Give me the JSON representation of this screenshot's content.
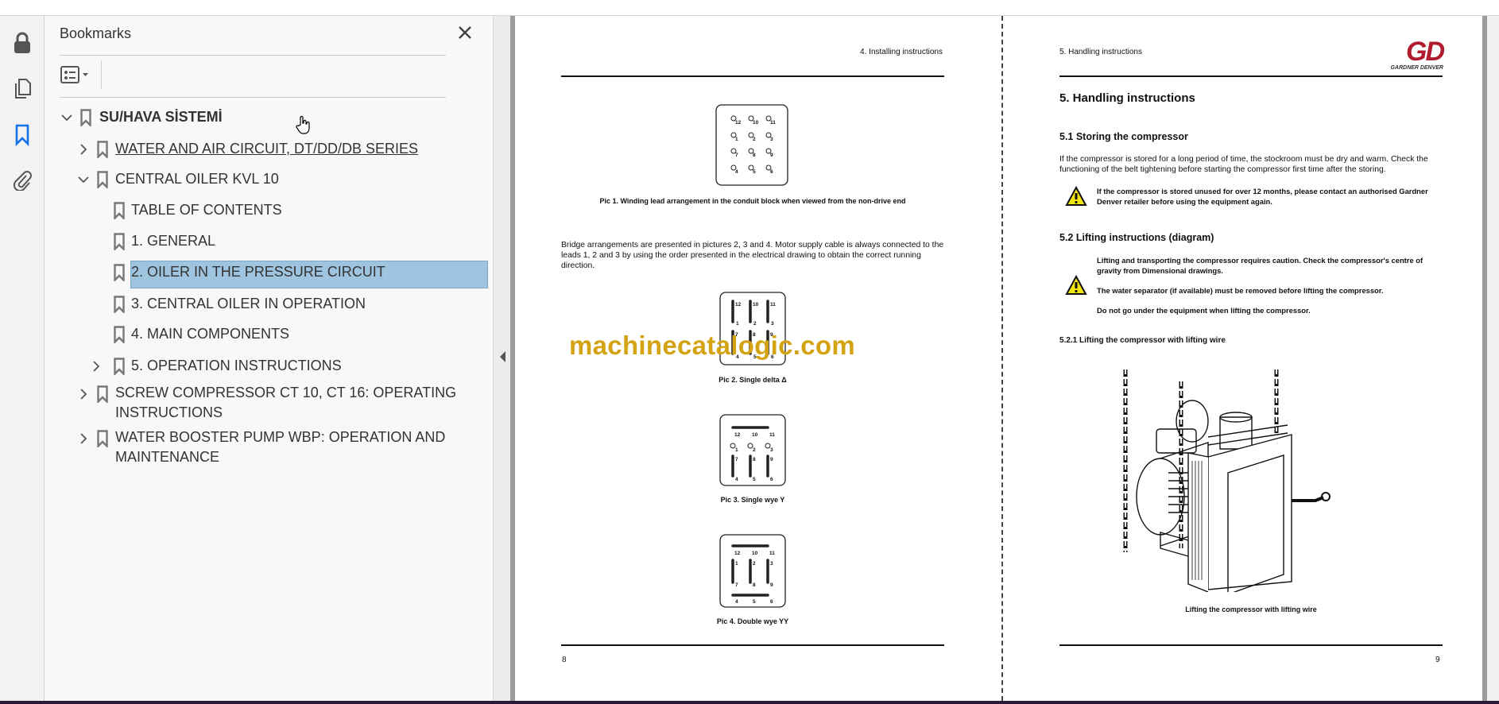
{
  "bookmarks_panel": {
    "title": "Bookmarks",
    "tree": [
      {
        "label": "SU/HAVA SİSTEMİ",
        "expanded": true
      },
      {
        "label": "WATER AND AIR CIRCUIT, DT/DD/DB SERIES",
        "expanded": false
      },
      {
        "label": "CENTRAL OILER KVL 10",
        "expanded": true
      },
      {
        "label": "TABLE OF CONTENTS"
      },
      {
        "label": "1. GENERAL"
      },
      {
        "label": "2. OILER IN THE PRESSURE CIRCUIT",
        "selected": true
      },
      {
        "label": "3. CENTRAL OILER IN OPERATION"
      },
      {
        "label": "4. MAIN COMPONENTS"
      },
      {
        "label": "5. OPERATION INSTRUCTIONS",
        "expanded": false
      },
      {
        "label_lines": [
          "SCREW COMPRESSOR CT 10, CT 16: OPERATING",
          "INSTRUCTIONS"
        ],
        "expanded": false
      },
      {
        "label_lines": [
          "WATER BOOSTER PUMP WBP: OPERATION AND",
          "MAINTENANCE"
        ],
        "expanded": false
      }
    ]
  },
  "page_left": {
    "header": "4. Installing instructions",
    "pic1_caption": "Pic 1. Winding lead arrangement in the conduit block when viewed from the non-drive end",
    "paragraph": "Bridge arrangements are presented in pictures 2, 3 and 4. Motor supply cable is always connected to the leads 1, 2 and 3 by using the order presented in the electrical drawing to obtain the correct running direction.",
    "pic2_caption": "Pic 2. Single delta Δ",
    "pic3_caption": "Pic 3. Single wye Y",
    "pic4_caption": "Pic 4. Double wye YY",
    "pin_rows": [
      [
        "12",
        "10",
        "11"
      ],
      [
        "1",
        "2",
        "3"
      ],
      [
        "7",
        "8",
        "9"
      ],
      [
        "4",
        "5",
        "6"
      ]
    ],
    "page_number": "8"
  },
  "watermark": "machinecatalogic.com",
  "page_right": {
    "header": "5. Handling instructions",
    "logo_text": "GD",
    "logo_subtext": "GARDNER DENVER",
    "h1": "5. Handling instructions",
    "s51_title": "5.1 Storing the compressor",
    "s51_text": "If the compressor is stored for a long period of time, the stockroom must be dry and warm. Check the functioning of the belt tightening before starting the compressor first time after the storing.",
    "s51_warning": "If the compressor is stored unused for over 12 months, please contact an authorised Gardner Denver retailer before using the equipment again.",
    "s52_title": "5.2 Lifting instructions (diagram)",
    "s52_warning1": "Lifting and transporting the compressor requires caution. Check the compressor's centre of gravity from Dimensional drawings.",
    "s52_warning2": "The water separator (if available) must be removed before lifting the compressor.",
    "s52_warning3": "Do not go under the equipment when lifting the compressor.",
    "s521_title": "5.2.1 Lifting the compressor with lifting wire",
    "figure_caption": "Lifting the compressor with lifting wire",
    "page_number": "9"
  },
  "colors": {
    "accent": "#1473e6",
    "selection": "#9fc4e0",
    "watermark": "#d4a314",
    "logo": "#b01c2e"
  }
}
